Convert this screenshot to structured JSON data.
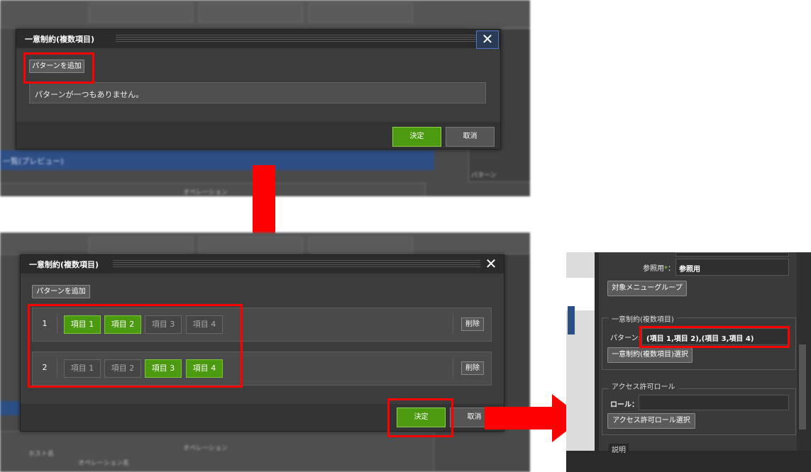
{
  "dialog1": {
    "title": "一意制約(複数項目)",
    "add_pattern": "パターンを追加",
    "empty_message": "パターンが一つもありません。",
    "ok": "決定",
    "cancel": "取消"
  },
  "dialog2": {
    "title": "一意制約(複数項目)",
    "add_pattern": "パターンを追加",
    "rows": [
      {
        "num": "1",
        "items": [
          {
            "label": "項目 1",
            "on": true
          },
          {
            "label": "項目 2",
            "on": true
          },
          {
            "label": "項目 3",
            "on": false
          },
          {
            "label": "項目 4",
            "on": false
          }
        ],
        "delete": "削除"
      },
      {
        "num": "2",
        "items": [
          {
            "label": "項目 1",
            "on": false
          },
          {
            "label": "項目 2",
            "on": false
          },
          {
            "label": "項目 3",
            "on": true
          },
          {
            "label": "項目 4",
            "on": true
          }
        ],
        "delete": "削除"
      }
    ],
    "ok": "決定",
    "cancel": "取消"
  },
  "background": {
    "preview_label": "一覧(プレビュー)",
    "operation_header": "オペレーション",
    "host_label": "ホスト名",
    "op_name": "オペレーション名",
    "pattern": "パターン"
  },
  "right_panel": {
    "ref_label": "参照用",
    "ref_value": "参照用",
    "menu_group_button": "対象メニューグループ",
    "unique_legend": "一意制約(複数項目)",
    "pattern_label": "パターン:",
    "pattern_value": "(項目 1,項目 2),(項目 3,項目 4)",
    "unique_select_button": "一意制約(複数項目)選択",
    "access_legend": "アクセス許可ロール",
    "role_label": "ロール：",
    "role_select_button": "アクセス許可ロール選択",
    "desc_legend": "説明"
  },
  "colors": {
    "accent_green": "#4c9a10",
    "highlight_red": "#ff0000",
    "dialog_bg": "#3c3c3c"
  }
}
